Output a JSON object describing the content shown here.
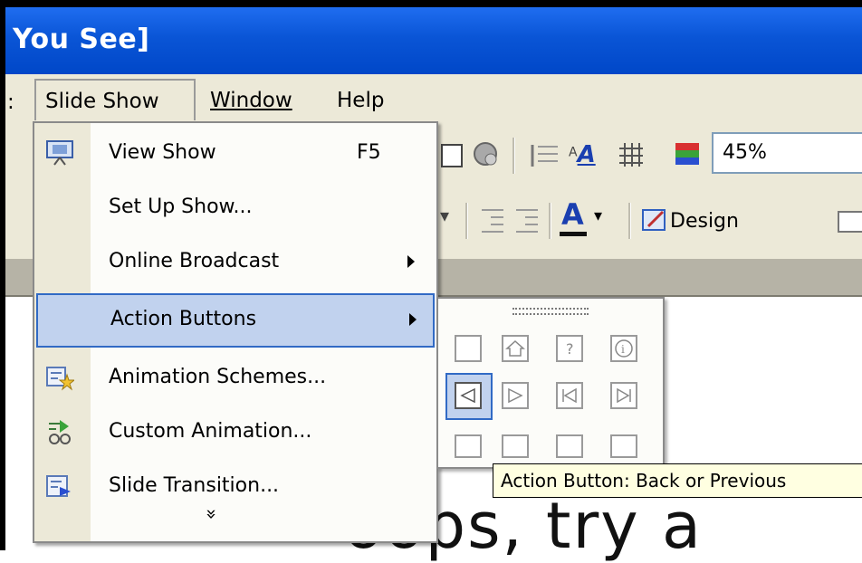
{
  "window": {
    "title": "You See]"
  },
  "menubar": {
    "items": [
      {
        "label": "Slide Show",
        "active": true
      },
      {
        "label": "Window"
      },
      {
        "label": "Help"
      }
    ]
  },
  "toolbar": {
    "zoom_value": "45%",
    "design_label": "Design",
    "font_color_letter": "A",
    "small_a_label": "A"
  },
  "slide_show_menu": {
    "items": [
      {
        "label": "View Show",
        "shortcut": "F5",
        "icon": "view-show-icon"
      },
      {
        "label": "Set Up Show..."
      },
      {
        "label": "Online Broadcast",
        "submenu": true
      },
      {
        "label": "Action Buttons",
        "submenu": true,
        "highlighted": true
      },
      {
        "label": "Animation Schemes...",
        "icon": "animation-schemes-icon"
      },
      {
        "label": "Custom Animation...",
        "icon": "custom-animation-icon"
      },
      {
        "label": "Slide Transition...",
        "icon": "slide-transition-icon"
      }
    ],
    "expand_glyph": "»"
  },
  "action_buttons_submenu": {
    "buttons": [
      "custom-action-button",
      "home-action-button",
      "help-action-button",
      "information-action-button",
      "back-previous-action-button",
      "forward-next-action-button",
      "beginning-action-button",
      "end-action-button",
      "return-action-button",
      "document-action-button",
      "sound-action-button",
      "movie-action-button"
    ],
    "selected": "back-previous-action-button"
  },
  "tooltip": {
    "text": "Action Button: Back or Previous"
  },
  "slide": {
    "visible_text": "oops, try a"
  },
  "colors": {
    "titlebar": "#0a55d6",
    "menu_highlight": "#c1d2ee",
    "menu_highlight_border": "#316ac5",
    "tooltip_bg": "#ffffe1"
  }
}
